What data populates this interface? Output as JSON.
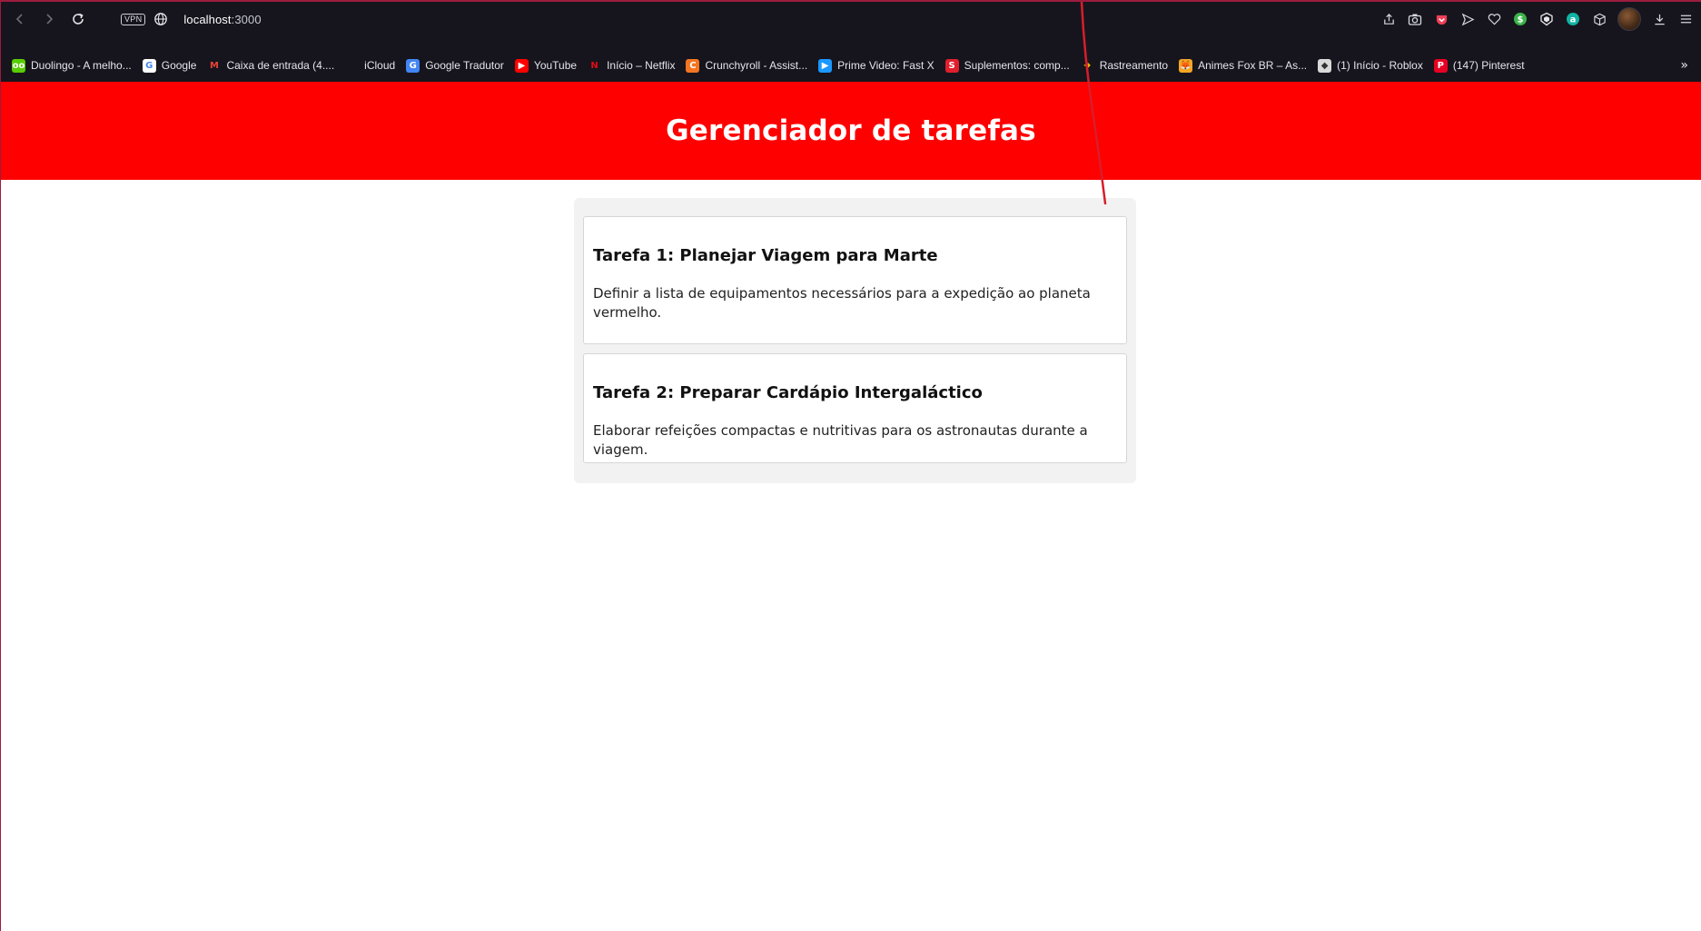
{
  "browser": {
    "url_host": "localhost",
    "url_port": ":3000",
    "vpn_label": "VPN",
    "bookmarks": [
      {
        "label": "Duolingo - A melho...",
        "icon": "duolingo-icon",
        "color": "#58cc02",
        "glyph": "oo"
      },
      {
        "label": "Google",
        "icon": "google-icon",
        "color": "#ffffff",
        "glyph": "G"
      },
      {
        "label": "Caixa de entrada (4....",
        "icon": "gmail-icon",
        "color": "#16151d",
        "glyph": "M"
      },
      {
        "label": "iCloud",
        "icon": "apple-icon",
        "color": "#16151d",
        "glyph": ""
      },
      {
        "label": "Google Tradutor",
        "icon": "google-translate-icon",
        "color": "#4285f4",
        "glyph": "G"
      },
      {
        "label": "YouTube",
        "icon": "youtube-icon",
        "color": "#ff0000",
        "glyph": "▶"
      },
      {
        "label": "Início – Netflix",
        "icon": "netflix-icon",
        "color": "#16151d",
        "glyph": "N"
      },
      {
        "label": "Crunchyroll - Assist...",
        "icon": "crunchyroll-icon",
        "color": "#f47521",
        "glyph": "C"
      },
      {
        "label": "Prime Video: Fast X",
        "icon": "prime-video-icon",
        "color": "#1a98ff",
        "glyph": "▶"
      },
      {
        "label": "Suplementos: comp...",
        "icon": "supplements-icon",
        "color": "#e01f2d",
        "glyph": "S"
      },
      {
        "label": "Rastreamento",
        "icon": "tracking-icon",
        "color": "#16151d",
        "glyph": "➜"
      },
      {
        "label": "Animes Fox BR – As...",
        "icon": "animes-fox-icon",
        "color": "#f5a623",
        "glyph": "🦊"
      },
      {
        "label": "(1) Início - Roblox",
        "icon": "roblox-icon",
        "color": "#d9d9d9",
        "glyph": "◆"
      },
      {
        "label": "(147) Pinterest",
        "icon": "pinterest-icon",
        "color": "#e60023",
        "glyph": "P"
      }
    ]
  },
  "app": {
    "title": "Gerenciador de tarefas",
    "accent_color": "#ff0000",
    "tasks": [
      {
        "title": "Tarefa 1: Planejar Viagem para Marte",
        "description": "Definir a lista de equipamentos necessários para a expedição ao planeta vermelho."
      },
      {
        "title": "Tarefa 2: Preparar Cardápio Intergaláctico",
        "description": "Elaborar refeições compactas e nutritivas para os astronautas durante a viagem."
      }
    ]
  }
}
